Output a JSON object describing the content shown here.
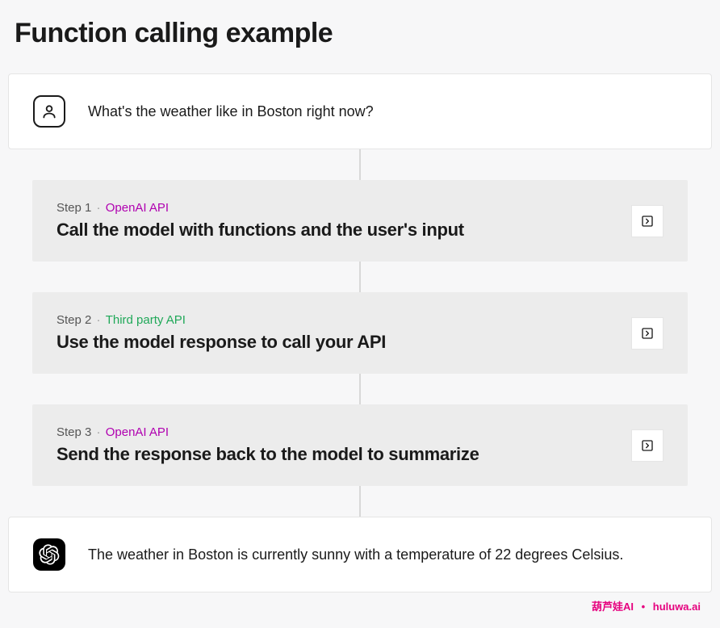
{
  "title": "Function calling example",
  "user_prompt": "What's the weather like in Boston right now?",
  "assistant_response": "The weather in Boston is currently sunny with a temperature of 22 degrees Celsius.",
  "steps": [
    {
      "label": "Step 1",
      "source": "OpenAI API",
      "source_type": "openai",
      "title": "Call the model with functions and the user's input"
    },
    {
      "label": "Step 2",
      "source": "Third party API",
      "source_type": "third",
      "title": "Use the model response to call your API"
    },
    {
      "label": "Step 3",
      "source": "OpenAI API",
      "source_type": "openai",
      "title": "Send the response back to the model to summarize"
    }
  ],
  "watermark": {
    "left": "葫芦娃AI",
    "right": "huluwa.ai"
  }
}
